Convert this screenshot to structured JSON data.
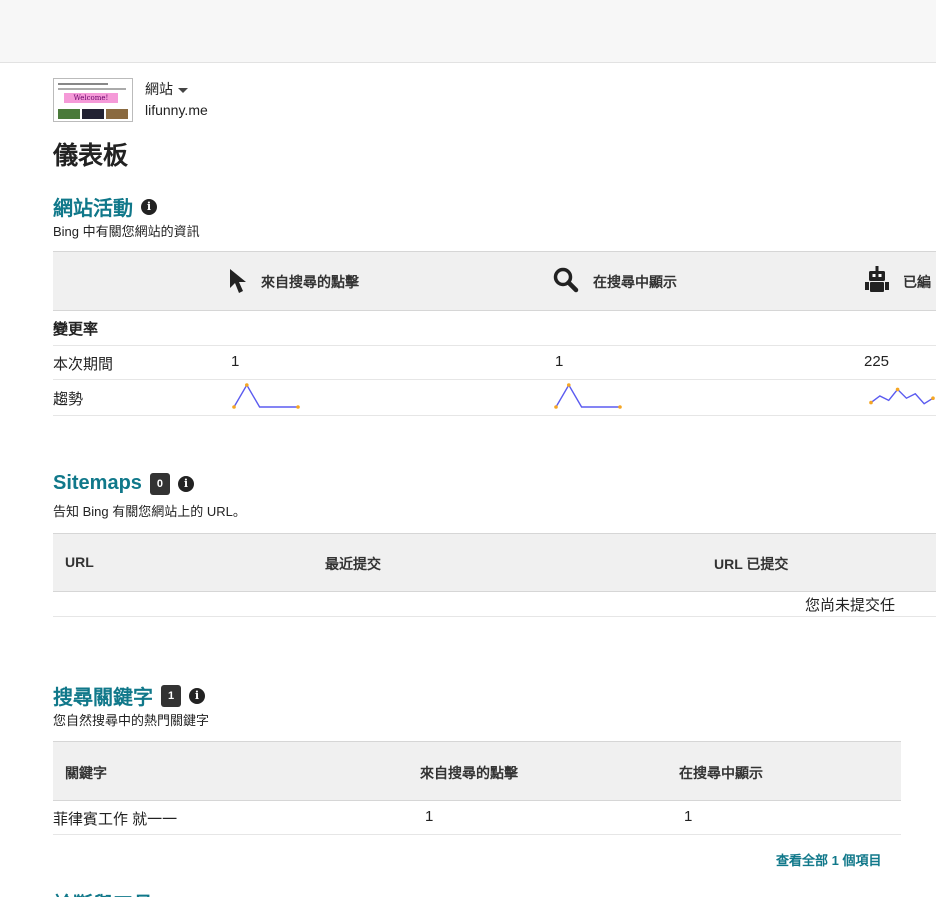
{
  "site": {
    "name": "網站",
    "url": "lifunny.me",
    "thumbnail": {
      "banner_text": "Welcome!"
    }
  },
  "page_title": "儀表板",
  "site_activity": {
    "title": "網站活動",
    "subtitle": "Bing 中有關您網站的資訊",
    "columns": [
      {
        "label": "來自搜尋的點擊",
        "icon": "cursor-icon"
      },
      {
        "label": "在搜尋中顯示",
        "icon": "magnifier-icon"
      },
      {
        "label": "已編",
        "icon": "robot-icon"
      }
    ],
    "change_rate_label": "變更率",
    "current_period_label": "本次期間",
    "current_values": [
      "1",
      "1",
      "225"
    ],
    "trend_label": "趨勢",
    "trend_color": "#5b5bf0",
    "trend_point_color": "#f5a623",
    "trends": [
      [
        0,
        1,
        0,
        0,
        0,
        0
      ],
      [
        0,
        1,
        0,
        0,
        0,
        0
      ],
      [
        0.2,
        0.5,
        0.3,
        0.8,
        0.4,
        0.6,
        0.15,
        0.4
      ]
    ]
  },
  "sitemaps": {
    "title": "Sitemaps",
    "count": "0",
    "subtitle": "告知 Bing 有關您網站上的 URL。",
    "columns": [
      "URL",
      "最近提交",
      "URL 已提交"
    ],
    "empty_message": "您尚未提交任"
  },
  "keywords": {
    "title": "搜尋關鍵字",
    "count": "1",
    "subtitle": "您自然搜尋中的熱門關鍵字",
    "columns": [
      "關鍵字",
      "來自搜尋的點擊",
      "在搜尋中顯示"
    ],
    "rows": [
      {
        "keyword": "菲律賓工作 就一一",
        "clicks": "1",
        "impressions": "1"
      }
    ],
    "view_all": "查看全部 1 個項目"
  },
  "next_section_title": "診斷與工具",
  "colors": {
    "accent": "#10788a",
    "badge": "#333333",
    "table_header_bg": "#f0f0f0"
  }
}
